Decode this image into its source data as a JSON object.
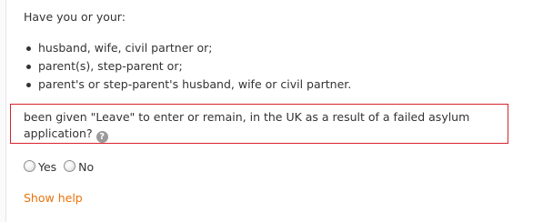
{
  "intro": "Have you or your:",
  "relations": [
    "husband, wife, civil partner or;",
    "parent(s), step-parent or;",
    "parent's or step-parent's husband, wife or civil partner."
  ],
  "question": {
    "text": "been given \"Leave\" to enter or remain, in the UK as a result of a failed asylum application?",
    "help_icon": "question-mark-icon",
    "help_glyph": "?"
  },
  "options": {
    "yes_label": "Yes",
    "no_label": "No",
    "selected": null
  },
  "show_help_label": "Show help",
  "colors": {
    "text": "#333333",
    "highlight_border": "#d9232a",
    "link": "#e9740c",
    "help_icon_bg": "#9a9a9a"
  }
}
